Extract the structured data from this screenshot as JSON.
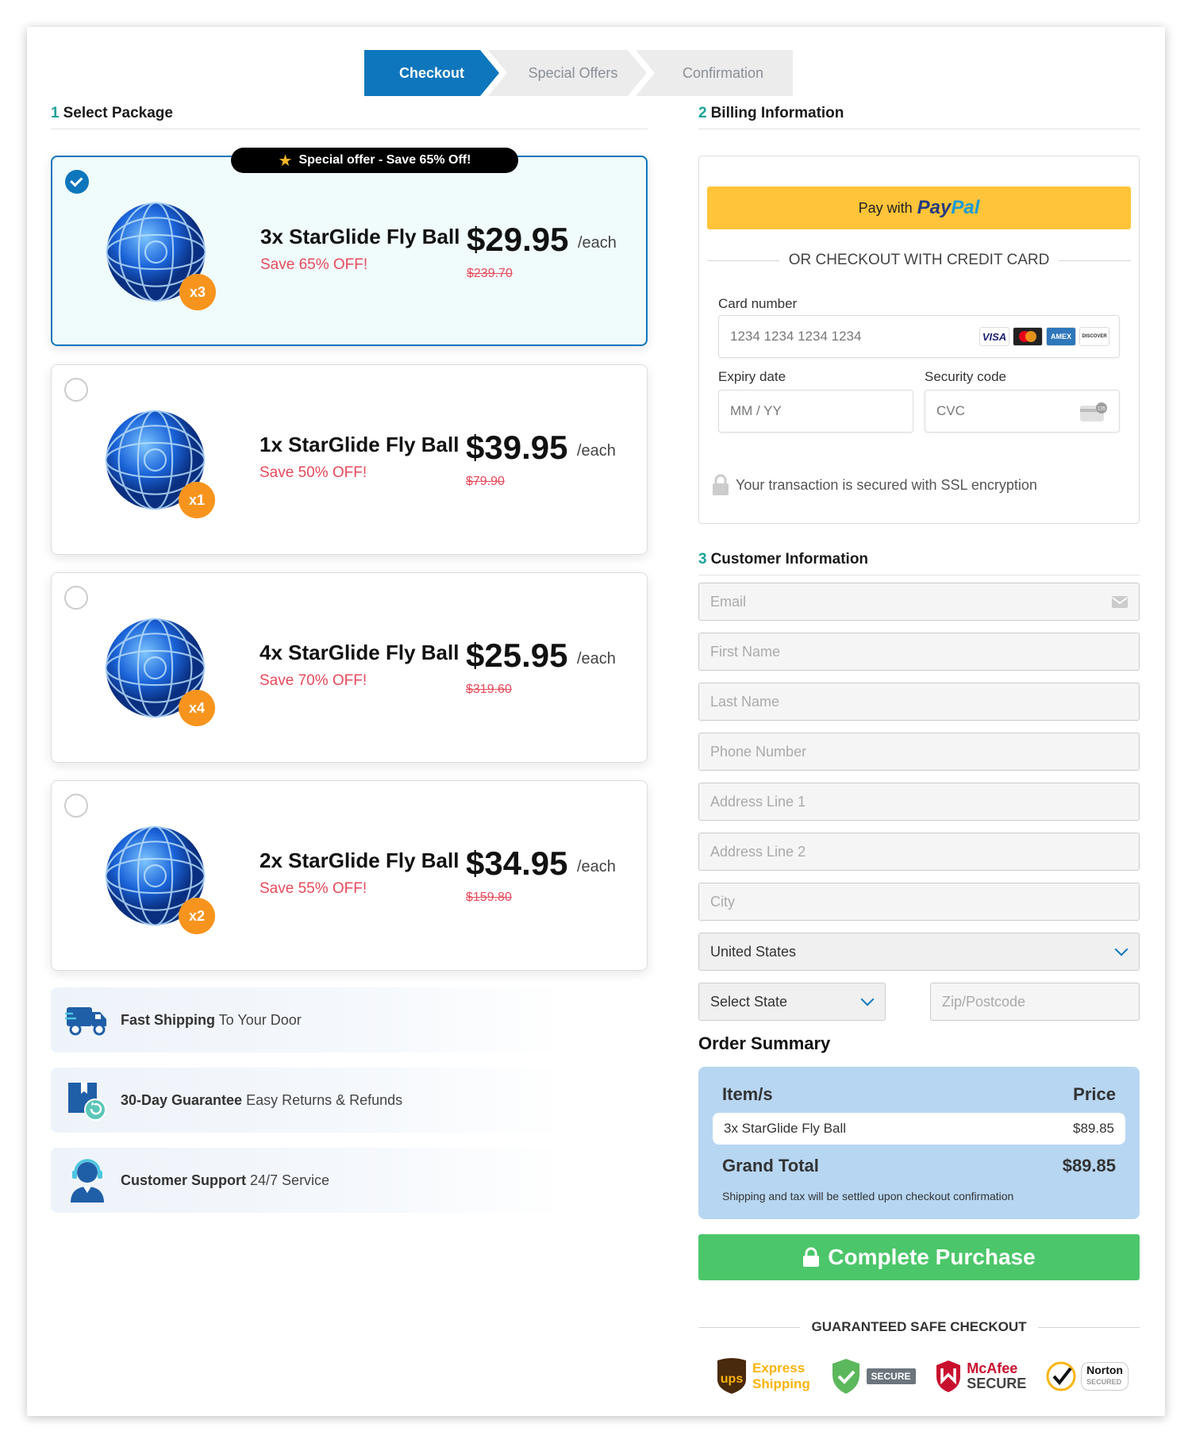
{
  "steps": [
    {
      "label": "Checkout",
      "active": true
    },
    {
      "label": "Special Offers",
      "active": false
    },
    {
      "label": "Confirmation",
      "active": false
    }
  ],
  "sections": {
    "package": {
      "num": "1",
      "title": "Select Package"
    },
    "billing": {
      "num": "2",
      "title": "Billing Information"
    },
    "customer": {
      "num": "3",
      "title": "Customer Information"
    }
  },
  "offer_banner": "Special offer - Save 65% Off!",
  "packages": [
    {
      "name": "3x StarGlide Fly Ball",
      "save": "Save 65% OFF!",
      "price": "$29.95",
      "per": "/each",
      "old_price": "$239.70",
      "qty": "x3",
      "selected": true
    },
    {
      "name": "1x StarGlide Fly Ball",
      "save": "Save 50% OFF!",
      "price": "$39.95",
      "per": "/each",
      "old_price": "$79.90",
      "qty": "x1",
      "selected": false
    },
    {
      "name": "4x StarGlide Fly Ball",
      "save": "Save 70% OFF!",
      "price": "$25.95",
      "per": "/each",
      "old_price": "$319.60",
      "qty": "x4",
      "selected": false
    },
    {
      "name": "2x StarGlide Fly Ball",
      "save": "Save 55% OFF!",
      "price": "$34.95",
      "per": "/each",
      "old_price": "$159.80",
      "qty": "x2",
      "selected": false
    }
  ],
  "benefits": [
    {
      "icon": "truck-icon",
      "bold": "Fast Shipping",
      "text": " To Your Door"
    },
    {
      "icon": "return-box-icon",
      "bold": "30-Day Guarantee",
      "text": " Easy Returns & Refunds"
    },
    {
      "icon": "support-agent-icon",
      "bold": "Customer Support",
      "text": " 24/7 Service"
    }
  ],
  "billing": {
    "paypal_prefix": "Pay with",
    "paypal_brand_1": "Pay",
    "paypal_brand_2": "Pal",
    "or_text": "OR CHECKOUT WITH CREDIT CARD",
    "card_label": "Card number",
    "card_placeholder": "1234 1234 1234 1234",
    "card_brands": [
      "VISA",
      "Mastercard",
      "AMEX",
      "DISCOVER"
    ],
    "expiry_label": "Expiry date",
    "expiry_placeholder": "MM / YY",
    "cvc_label": "Security code",
    "cvc_placeholder": "CVC",
    "ssl_text": "Your transaction is secured with SSL encryption"
  },
  "customer": {
    "email": "Email",
    "first_name": "First Name",
    "last_name": "Last Name",
    "phone": "Phone Number",
    "address1": "Address Line 1",
    "address2": "Address Line 2",
    "city": "City",
    "country": "United States",
    "state": "Select State",
    "zip": "Zip/Postcode"
  },
  "order_summary": {
    "title": "Order Summary",
    "col_item": "Item/s",
    "col_price": "Price",
    "items": [
      {
        "name": "3x StarGlide Fly Ball",
        "price": "$89.85"
      }
    ],
    "total_label": "Grand Total",
    "total_value": "$89.85",
    "note": "Shipping and tax will be settled upon checkout confirmation"
  },
  "complete_button": "Complete Purchase",
  "safe_checkout": "GUARANTEED SAFE CHECKOUT",
  "trust_badges": {
    "ups_1": "Express",
    "ups_2": "Shipping",
    "secure": "SECURE",
    "mcafee_1": "McAfee",
    "mcafee_2": "SECURE",
    "norton_1": "Norton",
    "norton_2": "SECURED"
  }
}
